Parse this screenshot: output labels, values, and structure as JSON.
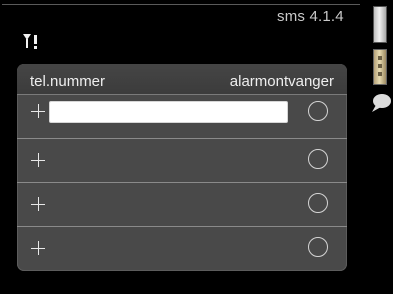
{
  "header": {
    "menu_id": "sms 4.1.4",
    "status_icon": "antenna-warning-icon"
  },
  "table": {
    "columns": {
      "phone": "tel.nummer",
      "alarm": "alarmontvanger"
    },
    "rows": [
      {
        "phone": "",
        "editing": true,
        "alarm_selected": false
      },
      {
        "phone": "",
        "editing": false,
        "alarm_selected": false
      },
      {
        "phone": "",
        "editing": false,
        "alarm_selected": false
      },
      {
        "phone": "",
        "editing": false,
        "alarm_selected": false
      }
    ]
  },
  "side": {
    "icons": [
      "scroll-track-icon",
      "scroll-grip-icon",
      "help-bubble-icon"
    ]
  },
  "colors": {
    "background": "#000000",
    "panel": "#494949",
    "input": "#ffffff"
  }
}
